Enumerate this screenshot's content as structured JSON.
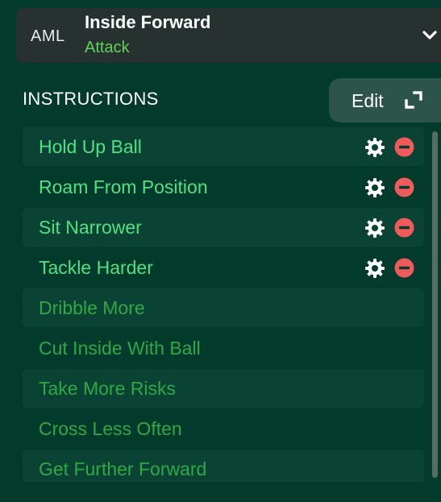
{
  "role": {
    "position": "AML",
    "name": "Inside Forward",
    "duty": "Attack"
  },
  "instructions": {
    "title": "INSTRUCTIONS",
    "edit_label": "Edit",
    "items": [
      {
        "label": "Hold Up Ball",
        "state": "active"
      },
      {
        "label": "Roam From Position",
        "state": "active"
      },
      {
        "label": "Sit Narrower",
        "state": "active"
      },
      {
        "label": "Tackle Harder",
        "state": "active"
      },
      {
        "label": "Dribble More",
        "state": "inactive"
      },
      {
        "label": "Cut Inside With Ball",
        "state": "inactive"
      },
      {
        "label": "Take More Risks",
        "state": "inactive"
      },
      {
        "label": "Cross Less Often",
        "state": "inactive"
      },
      {
        "label": "Get Further Forward",
        "state": "inactive"
      }
    ]
  },
  "colors": {
    "background": "#023a2c",
    "card": "#27312f",
    "active_text": "#4ee283",
    "inactive_text": "#2fa846",
    "duty_text": "#5fd35a",
    "remove_red": "#ef5b5b"
  },
  "icons": {
    "dropdown": "chevron-down-icon",
    "edit": "expand-icon",
    "settings": "gear-icon",
    "remove": "remove-icon"
  }
}
